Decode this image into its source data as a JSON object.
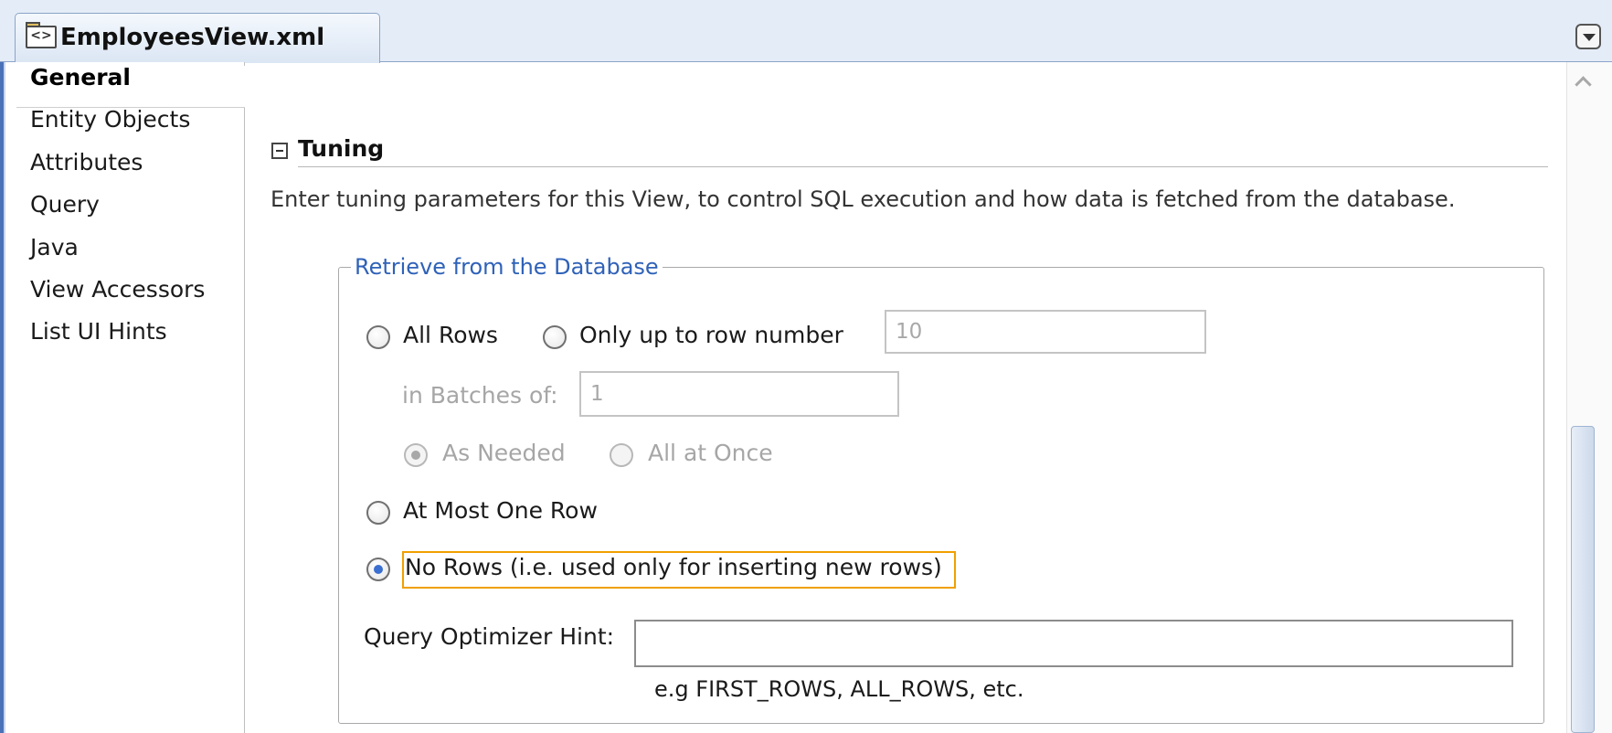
{
  "editor_tab": {
    "title": "EmployeesView.xml",
    "icon": "xml-file-icon"
  },
  "toolbar": {
    "menu_icon": "chevron-down-icon"
  },
  "navigator": {
    "items": [
      {
        "label": "General",
        "selected": true
      },
      {
        "label": "Entity Objects"
      },
      {
        "label": "Attributes"
      },
      {
        "label": "Query"
      },
      {
        "label": "Java"
      },
      {
        "label": "View Accessors"
      },
      {
        "label": "List UI Hints"
      }
    ]
  },
  "tuning": {
    "title": "Tuning",
    "description": "Enter tuning parameters for this View, to control SQL execution and how data is fetched from the database.",
    "group_title": "Retrieve from the Database",
    "options": {
      "all_rows": "All Rows",
      "only_up_to": "Only up to row number",
      "row_number_value": "10",
      "batches_label": "in Batches of:",
      "batches_value": "1",
      "as_needed": "As Needed",
      "all_at_once": "All at Once",
      "at_most_one": "At Most One Row",
      "no_rows": "No Rows (i.e. used only for inserting new rows)"
    },
    "selected_option": "no_rows",
    "hint_label": "Query Optimizer Hint:",
    "hint_value": "",
    "hint_example": "e.g FIRST_ROWS, ALL_ROWS, etc."
  }
}
